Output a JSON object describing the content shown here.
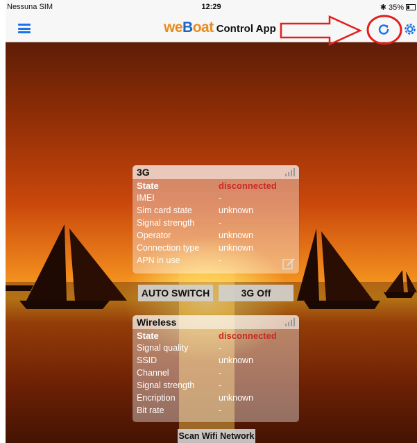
{
  "status_bar": {
    "carrier": "Nessuna SIM",
    "time": "12:29",
    "battery": "35%"
  },
  "nav": {
    "brand_prefix": "we",
    "brand_mid": "B",
    "brand_suffix": "oat",
    "title": "Control App"
  },
  "panel_3g": {
    "title": "3G",
    "rows": [
      {
        "label": "State",
        "value": "disconnected"
      },
      {
        "label": "IMEI",
        "value": "-"
      },
      {
        "label": "Sim card state",
        "value": "unknown"
      },
      {
        "label": "Signal strength",
        "value": "-"
      },
      {
        "label": "Operator",
        "value": "unknown"
      },
      {
        "label": "Connection type",
        "value": "unknown"
      },
      {
        "label": "APN in use",
        "value": "-"
      }
    ]
  },
  "buttons": {
    "auto_switch": "AUTO SWITCH",
    "toggle_3g": "3G Off",
    "scan_wifi": "Scan Wifi Network"
  },
  "panel_wireless": {
    "title": "Wireless",
    "rows": [
      {
        "label": "State",
        "value": "disconnected"
      },
      {
        "label": "Signal quality",
        "value": "-"
      },
      {
        "label": "SSID",
        "value": "unknown"
      },
      {
        "label": "Channel",
        "value": "-"
      },
      {
        "label": "Signal strength",
        "value": "-"
      },
      {
        "label": "Encription",
        "value": "unknown"
      },
      {
        "label": "Bit rate",
        "value": "-"
      }
    ]
  },
  "icons": {
    "menu": "hamburger-menu-icon",
    "refresh": "refresh-icon",
    "settings": "gear-icon",
    "signal": "signal-bars-icon",
    "edit": "edit-icon"
  },
  "colors": {
    "accent_blue": "#1a73e8",
    "status_red": "#c92a26",
    "brand_orange": "#e98b1b",
    "annotation_red": "#e0201b"
  }
}
